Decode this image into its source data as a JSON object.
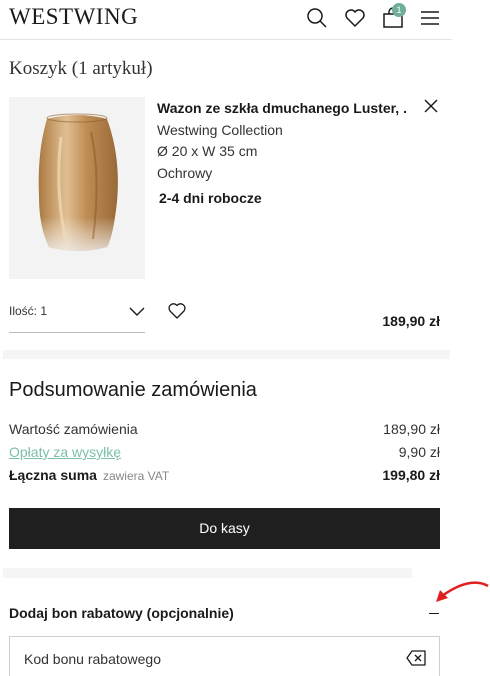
{
  "header": {
    "logo": "WESTWING",
    "cart_count": "1",
    "icons": [
      "search-icon",
      "heart-icon",
      "shopping-bag-icon",
      "menu-icon"
    ]
  },
  "cart": {
    "title": "Koszyk (1 artykuł)"
  },
  "product": {
    "name": "Wazon ze szkła dmuchanego Luster, ...",
    "brand": "Westwing Collection",
    "dimensions": "Ø 20 x W 35 cm",
    "color": "Ochrowy",
    "delivery": "2-4 dni robocze",
    "quantity_label": "Ilość: 1",
    "price": "189,90 zł"
  },
  "summary": {
    "title": "Podsumowanie zamówienia",
    "order_value_label": "Wartość zamówienia",
    "order_value": "189,90 zł",
    "shipping_label": "Opłaty za wysyłkę",
    "shipping_value": "9,90 zł",
    "total_label": "Łączna suma",
    "vat_note": "zawiera VAT",
    "total_value": "199,80 zł",
    "checkout_label": "Do kasy"
  },
  "voucher": {
    "title": "Dodaj bon rabatowy (opcjonalnie)",
    "placeholder": "Kod bonu rabatowego"
  },
  "colors": {
    "accent": "#7bbfa8",
    "badge": "#6fae9a",
    "button": "#1f1f1f",
    "annotation_arrow": "#e02020"
  }
}
